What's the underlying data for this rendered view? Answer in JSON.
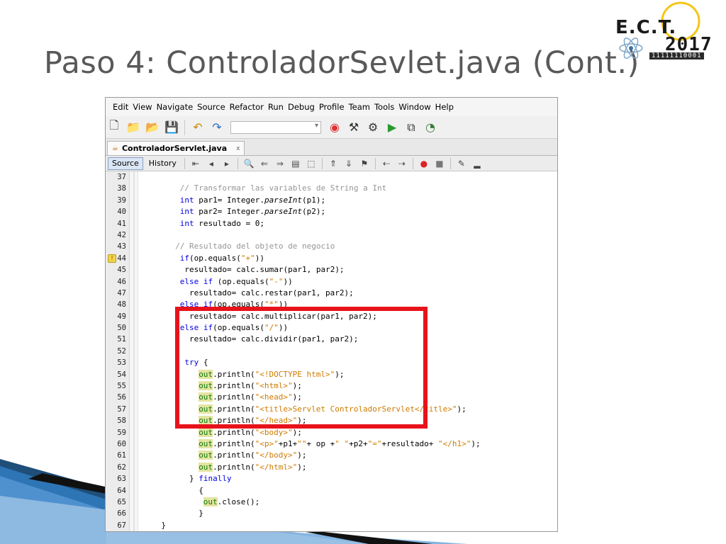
{
  "slide": {
    "title": "Paso 4: ControladorSevlet.java (Cont.)"
  },
  "logo": {
    "ect": "E.C.T.",
    "year": "2017",
    "binary": "11111110001"
  },
  "ide": {
    "menu": [
      "Edit",
      "View",
      "Navigate",
      "Source",
      "Refactor",
      "Run",
      "Debug",
      "Profile",
      "Team",
      "Tools",
      "Window",
      "Help"
    ],
    "toolbar_icons": [
      "new-file-icon",
      "new-project-icon",
      "open-project-icon",
      "save-all-icon",
      "undo-icon",
      "redo-icon",
      "browser-icon",
      "clean-build-icon",
      "build-icon",
      "run-icon",
      "debug-icon",
      "profile-icon"
    ],
    "file_tab": "ControladorServlet.java",
    "file_tab_close": "x",
    "editor_tabs": {
      "source": "Source",
      "history": "History"
    },
    "lines": [
      {
        "n": "37",
        "indent": 0,
        "parts": []
      },
      {
        "n": "38",
        "indent": 8,
        "parts": [
          {
            "t": "// Transformar las variables de String a Int",
            "c": "cm"
          }
        ]
      },
      {
        "n": "39",
        "indent": 8,
        "parts": [
          {
            "t": "int",
            "c": "kw"
          },
          {
            "t": " par1= Integer."
          },
          {
            "t": "parseInt",
            "c": "it"
          },
          {
            "t": "(p1);"
          }
        ]
      },
      {
        "n": "40",
        "indent": 8,
        "parts": [
          {
            "t": "int",
            "c": "kw"
          },
          {
            "t": " par2= Integer."
          },
          {
            "t": "parseInt",
            "c": "it"
          },
          {
            "t": "(p2);"
          }
        ]
      },
      {
        "n": "41",
        "indent": 8,
        "parts": [
          {
            "t": "int",
            "c": "kw"
          },
          {
            "t": " resultado = 0;"
          }
        ]
      },
      {
        "n": "42",
        "indent": 0,
        "parts": []
      },
      {
        "n": "43",
        "indent": 7,
        "parts": [
          {
            "t": "// Resultado del objeto de negocio",
            "c": "cm"
          }
        ]
      },
      {
        "n": "44",
        "indent": 8,
        "hint": true,
        "parts": [
          {
            "t": "if",
            "c": "kw"
          },
          {
            "t": "(op.equals("
          },
          {
            "t": "\"+\"",
            "c": "st"
          },
          {
            "t": "))"
          }
        ]
      },
      {
        "n": "45",
        "indent": 9,
        "parts": [
          {
            "t": "resultado= calc.sumar(par1, par2);"
          }
        ]
      },
      {
        "n": "46",
        "indent": 8,
        "parts": [
          {
            "t": "else if",
            "c": "kw"
          },
          {
            "t": " (op.equals("
          },
          {
            "t": "\"-\"",
            "c": "st"
          },
          {
            "t": "))"
          }
        ]
      },
      {
        "n": "47",
        "indent": 10,
        "parts": [
          {
            "t": "resultado= calc.restar(par1, par2);"
          }
        ]
      },
      {
        "n": "48",
        "indent": 8,
        "parts": [
          {
            "t": "else if",
            "c": "kw"
          },
          {
            "t": "(op.equals("
          },
          {
            "t": "\"*\"",
            "c": "st"
          },
          {
            "t": "))"
          }
        ]
      },
      {
        "n": "49",
        "indent": 10,
        "parts": [
          {
            "t": "resultado= calc.multiplicar(par1, par2);"
          }
        ]
      },
      {
        "n": "50",
        "indent": 8,
        "parts": [
          {
            "t": "else if",
            "c": "kw"
          },
          {
            "t": "(op.equals("
          },
          {
            "t": "\"/\"",
            "c": "st"
          },
          {
            "t": "))"
          }
        ]
      },
      {
        "n": "51",
        "indent": 10,
        "parts": [
          {
            "t": "resultado= calc.dividir(par1, par2);"
          }
        ]
      },
      {
        "n": "52",
        "indent": 0,
        "parts": []
      },
      {
        "n": "53",
        "indent": 9,
        "parts": [
          {
            "t": "try",
            "c": "kw"
          },
          {
            "t": " {"
          }
        ]
      },
      {
        "n": "54",
        "indent": 12,
        "parts": [
          {
            "t": "out",
            "c": "fld"
          },
          {
            "t": ".println("
          },
          {
            "t": "\"<!DOCTYPE html>\"",
            "c": "st"
          },
          {
            "t": ");"
          }
        ]
      },
      {
        "n": "55",
        "indent": 12,
        "parts": [
          {
            "t": "out",
            "c": "fld"
          },
          {
            "t": ".println("
          },
          {
            "t": "\"<html>\"",
            "c": "st"
          },
          {
            "t": ");"
          }
        ]
      },
      {
        "n": "56",
        "indent": 12,
        "parts": [
          {
            "t": "out",
            "c": "fld"
          },
          {
            "t": ".println("
          },
          {
            "t": "\"<head>\"",
            "c": "st"
          },
          {
            "t": ");"
          }
        ]
      },
      {
        "n": "57",
        "indent": 12,
        "parts": [
          {
            "t": "out",
            "c": "fld"
          },
          {
            "t": ".println("
          },
          {
            "t": "\"<title>Servlet ControladorServlet</title>\"",
            "c": "st"
          },
          {
            "t": ");"
          }
        ]
      },
      {
        "n": "58",
        "indent": 12,
        "parts": [
          {
            "t": "out",
            "c": "fld"
          },
          {
            "t": ".println("
          },
          {
            "t": "\"</head>\"",
            "c": "st"
          },
          {
            "t": ");"
          }
        ]
      },
      {
        "n": "59",
        "indent": 12,
        "parts": [
          {
            "t": "out",
            "c": "fld"
          },
          {
            "t": ".println("
          },
          {
            "t": "\"<body>\"",
            "c": "st"
          },
          {
            "t": ");"
          }
        ]
      },
      {
        "n": "60",
        "indent": 12,
        "parts": [
          {
            "t": "out",
            "c": "fld"
          },
          {
            "t": ".println("
          },
          {
            "t": "\"<p>\"",
            "c": "st"
          },
          {
            "t": "+p1+"
          },
          {
            "t": "\"\"",
            "c": "st"
          },
          {
            "t": "+ op +"
          },
          {
            "t": "\" \"",
            "c": "st"
          },
          {
            "t": "+p2+"
          },
          {
            "t": "\"=\"",
            "c": "st"
          },
          {
            "t": "+resultado+ "
          },
          {
            "t": "\"</h1>\"",
            "c": "st"
          },
          {
            "t": ");"
          }
        ]
      },
      {
        "n": "61",
        "indent": 12,
        "parts": [
          {
            "t": "out",
            "c": "fld"
          },
          {
            "t": ".println("
          },
          {
            "t": "\"</body>\"",
            "c": "st"
          },
          {
            "t": ");"
          }
        ]
      },
      {
        "n": "62",
        "indent": 12,
        "parts": [
          {
            "t": "out",
            "c": "fld"
          },
          {
            "t": ".println("
          },
          {
            "t": "\"</html>\"",
            "c": "st"
          },
          {
            "t": ");"
          }
        ]
      },
      {
        "n": "63",
        "indent": 10,
        "parts": [
          {
            "t": "} "
          },
          {
            "t": "finally",
            "c": "kw"
          }
        ]
      },
      {
        "n": "64",
        "indent": 12,
        "parts": [
          {
            "t": "{"
          }
        ]
      },
      {
        "n": "65",
        "indent": 13,
        "parts": [
          {
            "t": "out",
            "c": "fld"
          },
          {
            "t": ".close();"
          }
        ]
      },
      {
        "n": "66",
        "indent": 12,
        "parts": [
          {
            "t": "}"
          }
        ]
      },
      {
        "n": "67",
        "indent": 4,
        "parts": [
          {
            "t": "}"
          }
        ]
      }
    ]
  },
  "colors": {
    "highlight_box": "#e8121a",
    "keyword": "#0000e6",
    "comment": "#969696",
    "string": "#ce7b00"
  }
}
